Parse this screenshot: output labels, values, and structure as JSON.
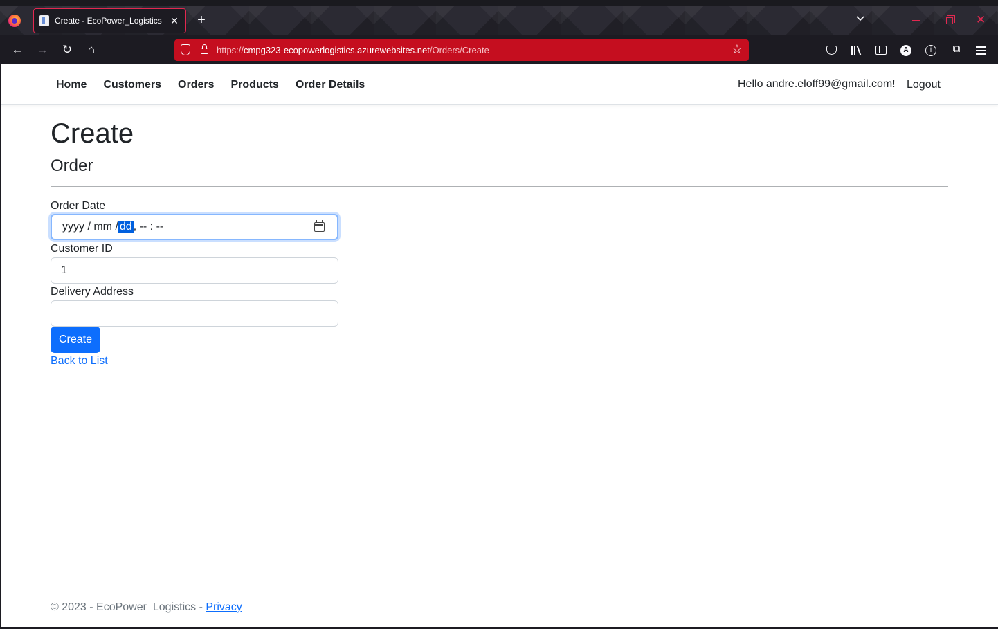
{
  "browser": {
    "tab_title": "Create - EcoPower_Logistics",
    "tab_close": "✕",
    "new_tab": "+",
    "url_scheme": "https://",
    "url_host": "cmpg323-ecopowerlogistics.azurewebsites.net",
    "url_path": "/Orders/Create",
    "account_initial": "A",
    "info_glyph": "i",
    "back": "←",
    "forward": "→",
    "reload": "↻",
    "home": "⌂",
    "bookmark_star": "☆",
    "extensions": "⧉",
    "close_window": "✕",
    "tab_list": "⌄",
    "accent_color": "#c50e1f"
  },
  "site_nav": {
    "home": "Home",
    "customers": "Customers",
    "orders": "Orders",
    "products": "Products",
    "order_details": "Order Details",
    "greeting": "Hello andre.eloff99@gmail.com!",
    "logout": "Logout"
  },
  "page": {
    "title": "Create",
    "subtitle": "Order"
  },
  "form": {
    "order_date_label": "Order Date",
    "order_date_year": "yyyy",
    "order_date_sep1": " / ",
    "order_date_month": "mm",
    "order_date_sep2": " /",
    "order_date_day": "dd",
    "order_date_time": ",  -- : --",
    "customer_id_label": "Customer ID",
    "customer_id_value": "1",
    "delivery_address_label": "Delivery Address",
    "delivery_address_value": "",
    "submit_label": "Create",
    "back_link": "Back to List"
  },
  "footer": {
    "copyright": "© 2023 - EcoPower_Logistics - ",
    "privacy": "Privacy"
  }
}
